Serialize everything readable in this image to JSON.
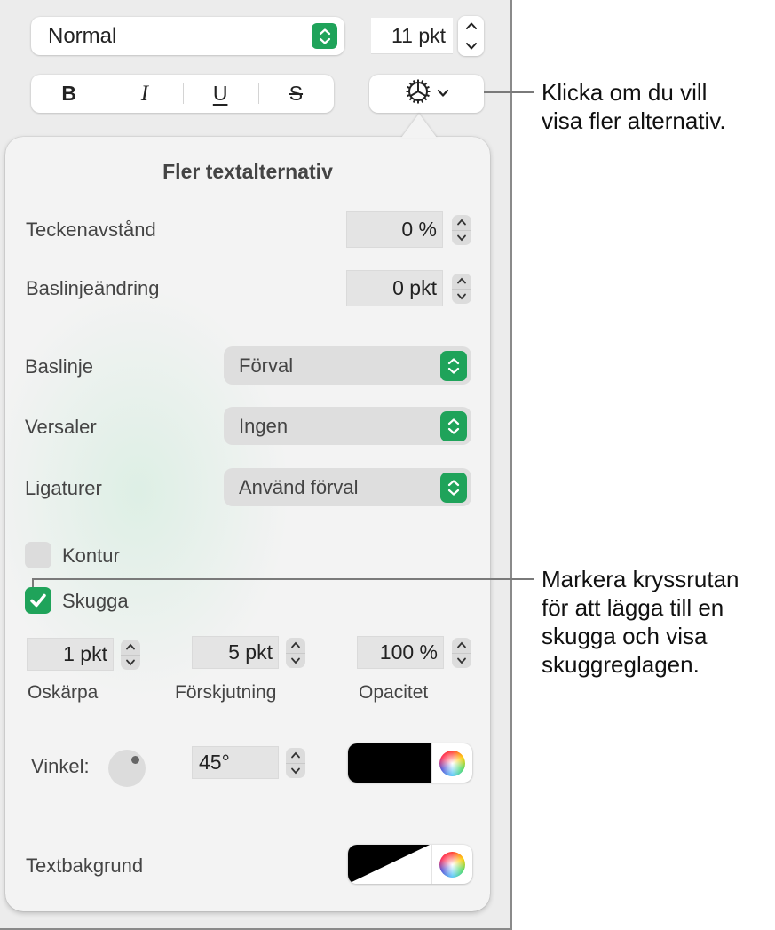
{
  "toolbar": {
    "paragraph_style": "Normal",
    "font_size": "11 pkt",
    "bold_label": "B",
    "italic_label": "I",
    "underline_label": "U",
    "strike_label": "S",
    "more_options_icon": "gear-icon"
  },
  "popover": {
    "title": "Fler textalternativ",
    "character_spacing": {
      "label": "Teckenavstånd",
      "value": "0 %"
    },
    "baseline_shift": {
      "label": "Baslinjeändring",
      "value": "0 pkt"
    },
    "baseline": {
      "label": "Baslinje",
      "value": "Förval"
    },
    "capitalization": {
      "label": "Versaler",
      "value": "Ingen"
    },
    "ligatures": {
      "label": "Ligaturer",
      "value": "Använd förval"
    },
    "outline": {
      "label": "Kontur",
      "checked": false
    },
    "shadow": {
      "label": "Skugga",
      "checked": true,
      "blur": {
        "label": "Oskärpa",
        "value": "1 pkt"
      },
      "offset": {
        "label": "Förskjutning",
        "value": "5 pkt"
      },
      "opacity": {
        "label": "Opacitet",
        "value": "100 %"
      },
      "angle": {
        "label": "Vinkel:",
        "value": "45°",
        "degrees": 45
      },
      "color": "#000000"
    },
    "text_background": {
      "label": "Textbakgrund",
      "color": "none"
    }
  },
  "callouts": {
    "more_options": [
      "Klicka om du vill",
      "visa fler alternativ."
    ],
    "shadow_checkbox": [
      "Markera kryssrutan",
      "för att lägga till en",
      "skugga och visa",
      "skuggreglagen."
    ]
  },
  "colors": {
    "accent": "#1fa35a"
  }
}
